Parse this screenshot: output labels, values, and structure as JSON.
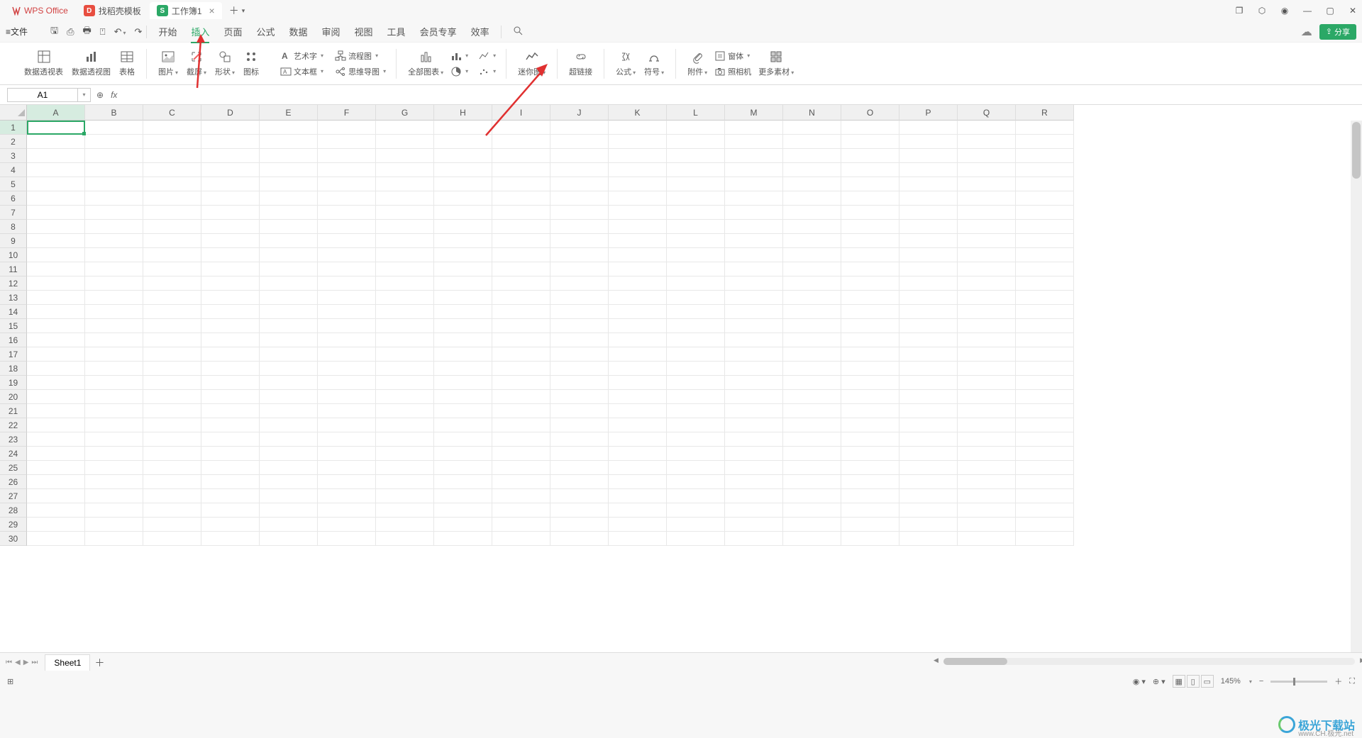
{
  "titlebar": {
    "app_name": "WPS Office",
    "template_tab": "找稻壳模板",
    "doc_tab": "工作簿1",
    "doc_badge": "S"
  },
  "menus": {
    "file": "文件",
    "items": [
      "开始",
      "插入",
      "页面",
      "公式",
      "数据",
      "审阅",
      "视图",
      "工具",
      "会员专享",
      "效率"
    ],
    "active_index": 1
  },
  "share_label": "分享",
  "ribbon": {
    "pivot_table": "数据透视表",
    "pivot_chart": "数据透视图",
    "table": "表格",
    "image": "图片",
    "screenshot": "截屏",
    "shapes": "形状",
    "icon": "图标",
    "artword": "艺术字",
    "textbox": "文本框",
    "flowchart": "流程图",
    "mindmap": "思维导图",
    "all_charts": "全部图表",
    "sparkline": "迷你图",
    "hyperlink": "超链接",
    "formula": "公式",
    "symbol": "符号",
    "attachment": "附件",
    "object": "窗体",
    "camera": "照相机",
    "more": "更多素材"
  },
  "cellref": "A1",
  "columns": [
    "A",
    "B",
    "C",
    "D",
    "E",
    "F",
    "G",
    "H",
    "I",
    "J",
    "K",
    "L",
    "M",
    "N",
    "O",
    "P",
    "Q",
    "R"
  ],
  "rows": [
    1,
    2,
    3,
    4,
    5,
    6,
    7,
    8,
    9,
    10,
    11,
    12,
    13,
    14,
    15,
    16,
    17,
    18,
    19,
    20,
    21,
    22,
    23,
    24,
    25,
    26,
    27,
    28,
    29,
    30
  ],
  "sheet": "Sheet1",
  "zoom": "145%",
  "status_left": "",
  "watermark": "极光下载站",
  "watermark_sub": "www.CH.极光.net"
}
